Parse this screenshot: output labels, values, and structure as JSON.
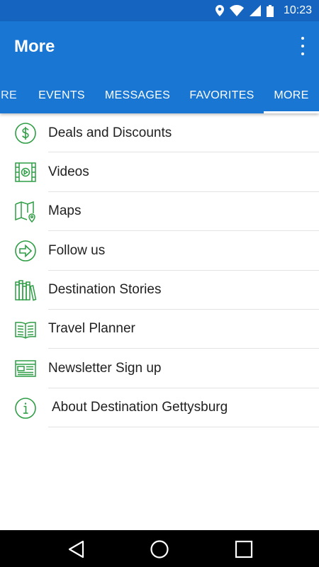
{
  "status_bar": {
    "time": "10:23",
    "icons": [
      "location-icon",
      "wifi-icon",
      "signal-icon",
      "battery-icon"
    ]
  },
  "app_bar": {
    "title": "More",
    "overflow_icon": "more-vert-icon",
    "color": "#1976d2"
  },
  "tabs": [
    {
      "label": "ORE",
      "active": false
    },
    {
      "label": "EVENTS",
      "active": false
    },
    {
      "label": "MESSAGES",
      "active": false
    },
    {
      "label": "FAVORITES",
      "active": false
    },
    {
      "label": "MORE",
      "active": true
    }
  ],
  "menu": {
    "icon_color": "#2e9e45",
    "items": [
      {
        "label": "Deals and Discounts",
        "icon": "dollar-circle-icon"
      },
      {
        "label": "Videos",
        "icon": "video-film-icon"
      },
      {
        "label": "Maps",
        "icon": "map-pin-icon"
      },
      {
        "label": "Follow us",
        "icon": "arrow-circle-icon"
      },
      {
        "label": "Destination Stories",
        "icon": "books-icon"
      },
      {
        "label": "Travel Planner",
        "icon": "open-book-icon"
      },
      {
        "label": "Newsletter Sign up",
        "icon": "newsletter-icon"
      },
      {
        "label": "About Destination Gettysburg",
        "icon": "info-circle-icon"
      }
    ]
  },
  "nav_bar": {
    "buttons": [
      "back-icon",
      "home-icon",
      "recents-icon"
    ]
  }
}
